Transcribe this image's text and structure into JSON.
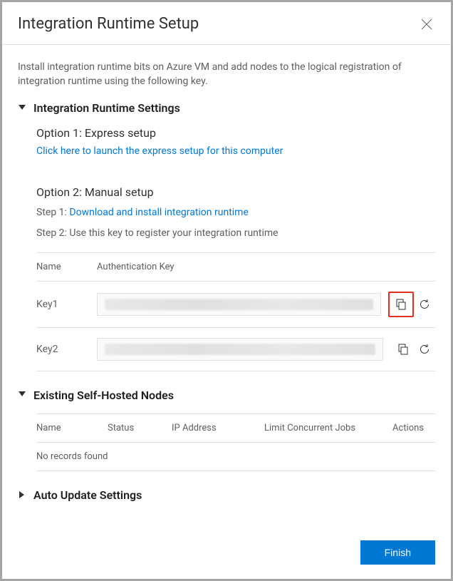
{
  "dialog": {
    "title": "Integration Runtime Setup",
    "description": "Install integration runtime bits on Azure VM and add nodes to the logical registration of integration runtime using the following key."
  },
  "sections": {
    "settings": {
      "title": "Integration Runtime Settings",
      "option1": {
        "title": "Option 1: Express setup",
        "link": "Click here to launch the express setup for this computer"
      },
      "option2": {
        "title": "Option 2: Manual setup",
        "step1_prefix": "Step 1: ",
        "step1_link": "Download and install integration runtime",
        "step2": "Step 2: Use this key to register your integration runtime"
      },
      "keys": {
        "header_name": "Name",
        "header_key": "Authentication Key",
        "rows": [
          {
            "name": "Key1"
          },
          {
            "name": "Key2"
          }
        ]
      }
    },
    "nodes": {
      "title": "Existing Self-Hosted Nodes",
      "columns": {
        "name": "Name",
        "status": "Status",
        "ip": "IP Address",
        "jobs": "Limit Concurrent Jobs",
        "actions": "Actions"
      },
      "empty": "No records found"
    },
    "auto_update": {
      "title": "Auto Update Settings"
    }
  },
  "buttons": {
    "finish": "Finish"
  }
}
